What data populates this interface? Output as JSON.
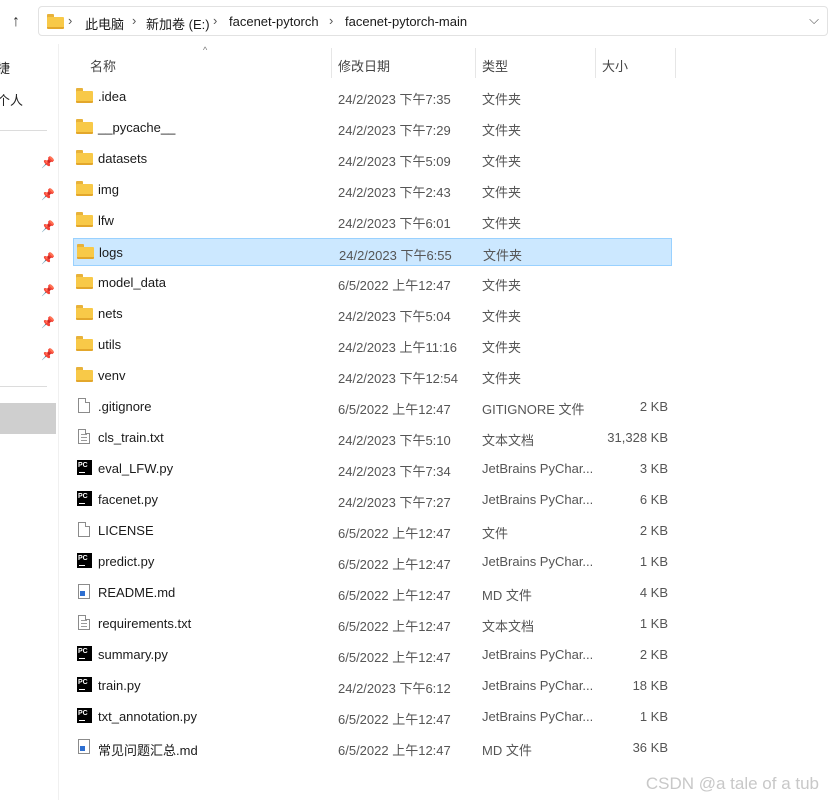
{
  "address": {
    "back_glyph": "↑",
    "crumbs": [
      "此电脑",
      "新加卷 (E:)",
      "facenet-pytorch",
      "facenet-pytorch-main"
    ]
  },
  "nav": {
    "partial_labels": [
      "捷",
      "个人"
    ],
    "pins": 7
  },
  "columns": {
    "name": "名称",
    "modified": "修改日期",
    "type": "类型",
    "size": "大小"
  },
  "files": [
    {
      "name": ".idea",
      "modified": "24/2/2023 下午7:35",
      "type": "文件夹",
      "size": "",
      "icon": "folder-icon"
    },
    {
      "name": "__pycache__",
      "modified": "24/2/2023 下午7:29",
      "type": "文件夹",
      "size": "",
      "icon": "folder-icon"
    },
    {
      "name": "datasets",
      "modified": "24/2/2023 下午5:09",
      "type": "文件夹",
      "size": "",
      "icon": "folder-icon"
    },
    {
      "name": "img",
      "modified": "24/2/2023 下午2:43",
      "type": "文件夹",
      "size": "",
      "icon": "folder-icon"
    },
    {
      "name": "lfw",
      "modified": "24/2/2023 下午6:01",
      "type": "文件夹",
      "size": "",
      "icon": "folder-icon"
    },
    {
      "name": "logs",
      "modified": "24/2/2023 下午6:55",
      "type": "文件夹",
      "size": "",
      "icon": "folder-icon",
      "selected": true
    },
    {
      "name": "model_data",
      "modified": "6/5/2022 上午12:47",
      "type": "文件夹",
      "size": "",
      "icon": "folder-icon"
    },
    {
      "name": "nets",
      "modified": "24/2/2023 下午5:04",
      "type": "文件夹",
      "size": "",
      "icon": "folder-icon"
    },
    {
      "name": "utils",
      "modified": "24/2/2023 上午11:16",
      "type": "文件夹",
      "size": "",
      "icon": "folder-icon"
    },
    {
      "name": "venv",
      "modified": "24/2/2023 下午12:54",
      "type": "文件夹",
      "size": "",
      "icon": "folder-icon"
    },
    {
      "name": ".gitignore",
      "modified": "6/5/2022 上午12:47",
      "type": "GITIGNORE 文件",
      "size": "2 KB",
      "icon": "file-icon"
    },
    {
      "name": "cls_train.txt",
      "modified": "24/2/2023 下午5:10",
      "type": "文本文档",
      "size": "31,328 KB",
      "icon": "text-file-icon"
    },
    {
      "name": "eval_LFW.py",
      "modified": "24/2/2023 下午7:34",
      "type": "JetBrains PyChar...",
      "size": "3 KB",
      "icon": "pycharm-icon"
    },
    {
      "name": "facenet.py",
      "modified": "24/2/2023 下午7:27",
      "type": "JetBrains PyChar...",
      "size": "6 KB",
      "icon": "pycharm-icon"
    },
    {
      "name": "LICENSE",
      "modified": "6/5/2022 上午12:47",
      "type": "文件",
      "size": "2 KB",
      "icon": "file-icon"
    },
    {
      "name": "predict.py",
      "modified": "6/5/2022 上午12:47",
      "type": "JetBrains PyChar...",
      "size": "1 KB",
      "icon": "pycharm-icon"
    },
    {
      "name": "README.md",
      "modified": "6/5/2022 上午12:47",
      "type": "MD 文件",
      "size": "4 KB",
      "icon": "markdown-icon"
    },
    {
      "name": "requirements.txt",
      "modified": "6/5/2022 上午12:47",
      "type": "文本文档",
      "size": "1 KB",
      "icon": "text-file-icon"
    },
    {
      "name": "summary.py",
      "modified": "6/5/2022 上午12:47",
      "type": "JetBrains PyChar...",
      "size": "2 KB",
      "icon": "pycharm-icon"
    },
    {
      "name": "train.py",
      "modified": "24/2/2023 下午6:12",
      "type": "JetBrains PyChar...",
      "size": "18 KB",
      "icon": "pycharm-icon"
    },
    {
      "name": "txt_annotation.py",
      "modified": "6/5/2022 上午12:47",
      "type": "JetBrains PyChar...",
      "size": "1 KB",
      "icon": "pycharm-icon"
    },
    {
      "name": "常见问题汇总.md",
      "modified": "6/5/2022 上午12:47",
      "type": "MD 文件",
      "size": "36 KB",
      "icon": "markdown-icon"
    }
  ],
  "watermark": "CSDN @a tale of a tub",
  "colors": {
    "selection_bg": "#cce8ff",
    "selection_border": "#99d1ff",
    "folder": "#f8c948"
  }
}
